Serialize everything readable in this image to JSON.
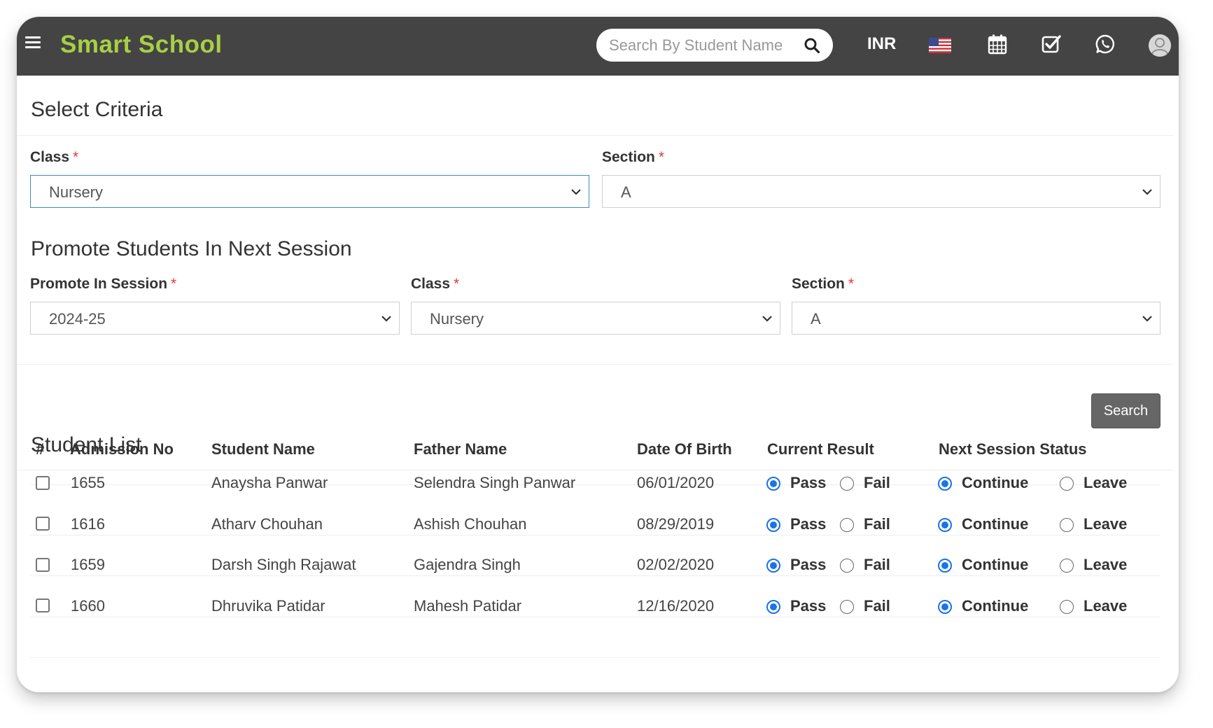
{
  "app": {
    "brand": "Smart School",
    "search_placeholder": "Search By Student Name",
    "currency": "INR"
  },
  "criteria": {
    "title": "Select Criteria",
    "class_label": "Class",
    "class_value": "Nursery",
    "section_label": "Section",
    "section_value": "A"
  },
  "promote": {
    "title": "Promote Students In Next Session",
    "session_label": "Promote In Session",
    "session_value": "2024-25",
    "class_label": "Class",
    "class_value": "Nursery",
    "section_label": "Section",
    "section_value": "A",
    "required_mark": "*"
  },
  "search_button": "Search",
  "student_list": {
    "title": "Student List",
    "columns": [
      "#",
      "Admission No",
      "Student Name",
      "Father Name",
      "Date Of Birth",
      "Current Result",
      "Next Session Status"
    ],
    "result_options": [
      "Pass",
      "Fail"
    ],
    "status_options": [
      "Continue",
      "Leave"
    ],
    "rows": [
      {
        "admission_no": "1655",
        "student_name": "Anaysha Panwar",
        "father_name": "Selendra Singh Panwar",
        "dob": "06/01/2020",
        "result": "Pass",
        "status": "Continue"
      },
      {
        "admission_no": "1616",
        "student_name": "Atharv Chouhan",
        "father_name": "Ashish Chouhan",
        "dob": "08/29/2019",
        "result": "Pass",
        "status": "Continue"
      },
      {
        "admission_no": "1659",
        "student_name": "Darsh Singh Rajawat",
        "father_name": "Gajendra Singh",
        "dob": "02/02/2020",
        "result": "Pass",
        "status": "Continue"
      },
      {
        "admission_no": "1660",
        "student_name": "Dhruvika Patidar",
        "father_name": "Mahesh Patidar",
        "dob": "12/16/2020",
        "result": "Pass",
        "status": "Continue"
      }
    ]
  },
  "colors": {
    "topbar": "#444444",
    "brand": "#a8cf45",
    "radio_selected": "#1a73e8",
    "required": "#e53935"
  },
  "icons": [
    "menu-icon",
    "search-icon",
    "us-flag-icon",
    "calendar-icon",
    "checkbox-task-icon",
    "whatsapp-icon",
    "user-avatar-icon",
    "chevron-down-icon"
  ]
}
